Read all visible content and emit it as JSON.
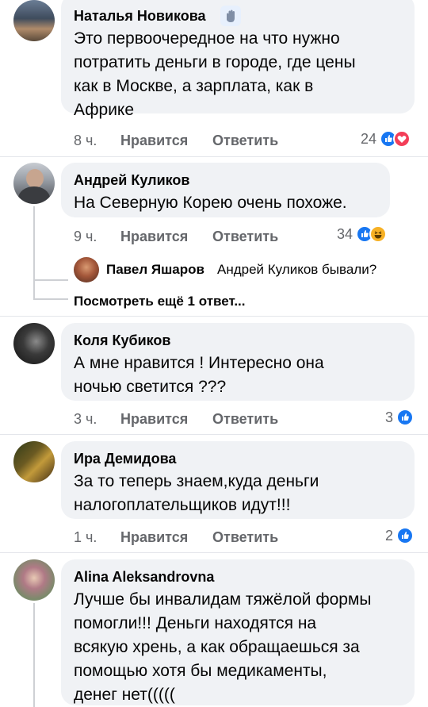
{
  "comments": [
    {
      "author": "Наталья Новикова",
      "badge_icon": "wave-hand-icon",
      "text_lines": [
        "Это первоочередное на что нужно",
        "потратить деньги в городе, где цены",
        "как в Москве, а зарплата, как в",
        "Африке"
      ],
      "time": "8 ч.",
      "like_label": "Нравится",
      "reply_label": "Ответить",
      "reactions_count": "24",
      "reaction_icons": [
        "like-icon",
        "love-icon"
      ]
    },
    {
      "author": "Андрей Куликов",
      "text_lines": [
        "На Северную Корею очень похоже."
      ],
      "time": "9 ч.",
      "like_label": "Нравится",
      "reply_label": "Ответить",
      "reactions_count": "34",
      "reaction_icons": [
        "like-icon",
        "haha-icon"
      ],
      "reply": {
        "author": "Павел Яшаров",
        "text": "Андрей Куликов бывали?"
      },
      "more_replies": "Посмотреть ещё 1 ответ..."
    },
    {
      "author": "Коля Кубиков",
      "text_lines": [
        "А мне нравится ! Интересно она",
        "ночью светится ???"
      ],
      "time": "3 ч.",
      "like_label": "Нравится",
      "reply_label": "Ответить",
      "reactions_count": "3",
      "reaction_icons": [
        "like-icon"
      ]
    },
    {
      "author": "Ира Демидова",
      "text_lines": [
        "За то теперь знаем,куда деньги",
        "налогоплательщиков идут!!!"
      ],
      "time": "1 ч.",
      "like_label": "Нравится",
      "reply_label": "Ответить",
      "reactions_count": "2",
      "reaction_icons": [
        "like-icon"
      ]
    },
    {
      "author": "Alina Aleksandrovna",
      "text_lines": [
        "Лучше бы инвалидам тяжёлой формы",
        "помогли!!! Деньги находятся на",
        "всякую хрень, а как обращаешься за",
        "помощью хотя бы медикаменты,",
        "денег нет((((("
      ]
    }
  ],
  "colors": {
    "bubble": "#f0f2f5",
    "meta": "#65676b",
    "like_blue": "#1877f2",
    "love_red": "#f33e58",
    "haha_yellow": "#f7b125"
  }
}
